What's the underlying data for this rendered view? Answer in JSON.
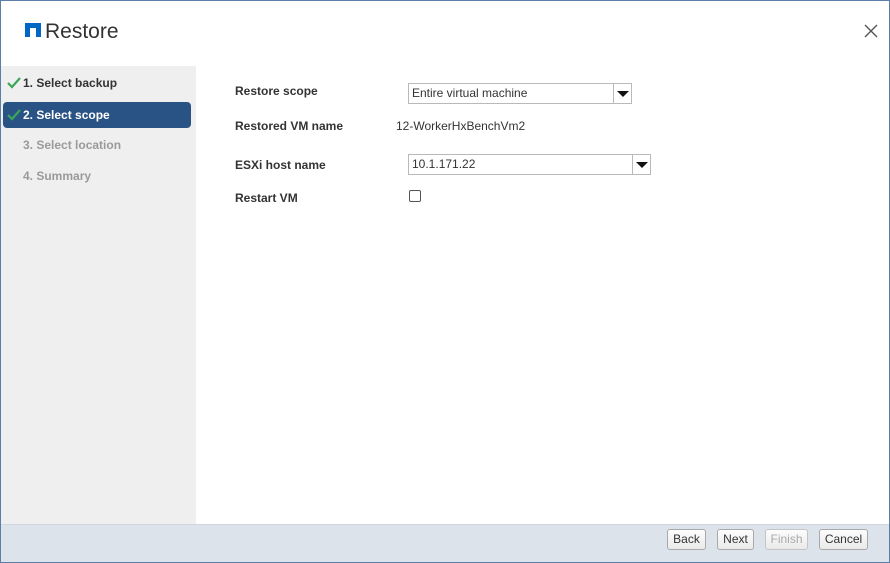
{
  "dialog": {
    "title": "Restore",
    "logo_icon": "netapp-logo-icon",
    "close_icon": "close-icon"
  },
  "steps": [
    {
      "label": "1. Select backup",
      "state": "done"
    },
    {
      "label": "2. Select scope",
      "state": "active"
    },
    {
      "label": "3. Select location",
      "state": "todo"
    },
    {
      "label": "4. Summary",
      "state": "todo"
    }
  ],
  "form": {
    "restore_scope_label": "Restore scope",
    "restore_scope_value": "Entire virtual machine",
    "restored_vm_name_label": "Restored VM name",
    "restored_vm_name_value": "12-WorkerHxBenchVm2",
    "esxi_host_label": "ESXi host name",
    "esxi_host_value": "10.1.171.22",
    "restart_vm_label": "Restart VM",
    "restart_vm_checked": false
  },
  "footer": {
    "back": "Back",
    "next": "Next",
    "finish": "Finish",
    "cancel": "Cancel"
  },
  "colors": {
    "accent": "#2a5385",
    "check": "#3aa657",
    "logo": "#0067c5"
  }
}
